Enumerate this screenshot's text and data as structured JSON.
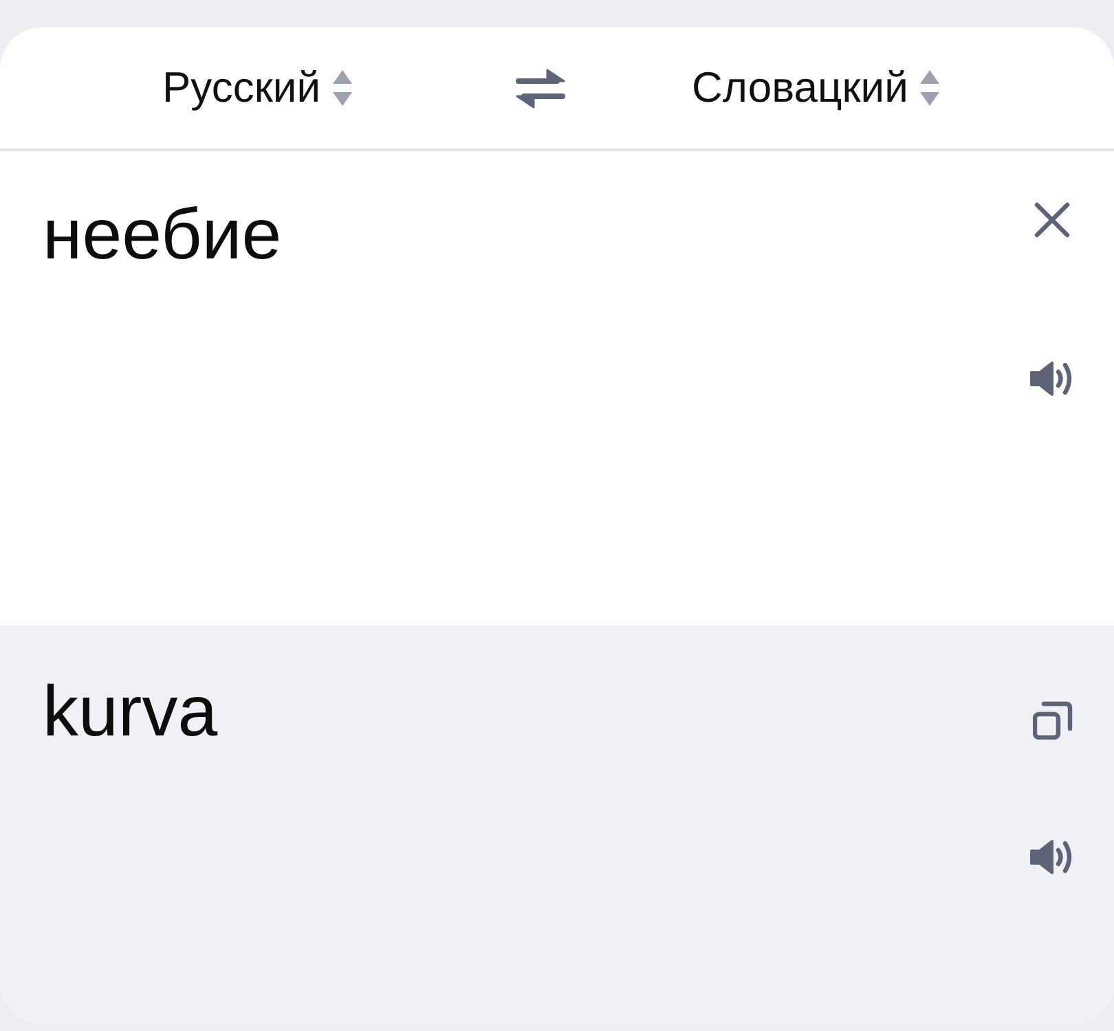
{
  "header": {
    "source_language": "Русский",
    "target_language": "Словацкий"
  },
  "source": {
    "value": "неебие"
  },
  "translation": {
    "text": "kurva"
  }
}
